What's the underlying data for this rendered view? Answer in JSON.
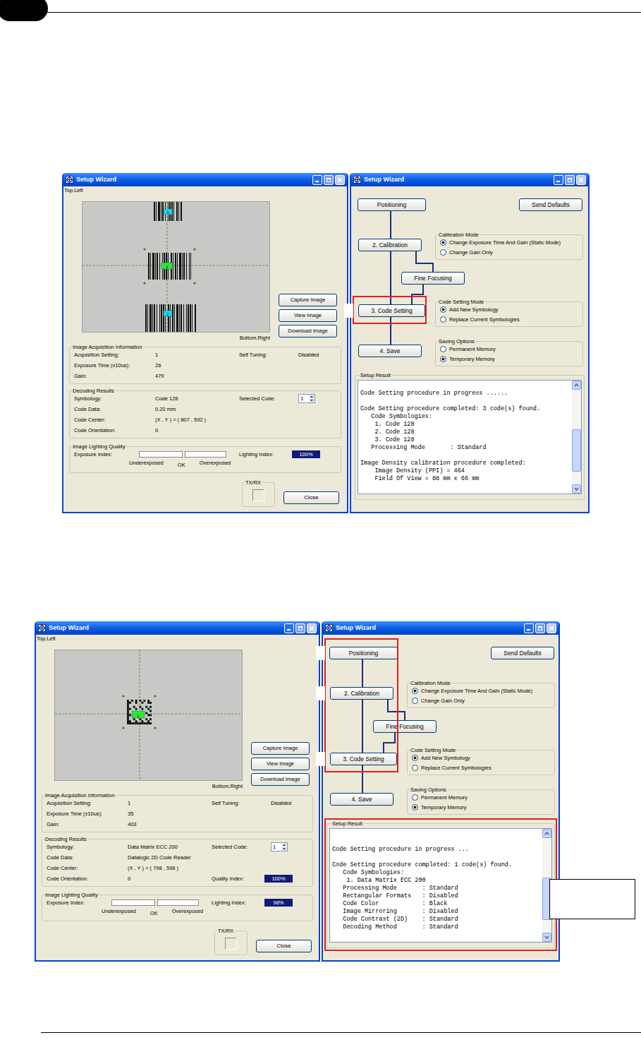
{
  "figures": [
    {
      "left_window": {
        "title": "Setup Wizard",
        "corner_top_left": "Top,Left",
        "corner_bottom_right": "Bottom,Right",
        "image": {
          "kind": "linear",
          "codes": [
            {
              "label": "3",
              "selected": false
            },
            {
              "label": "1",
              "selected": true
            },
            {
              "label": "2",
              "selected": false
            }
          ]
        },
        "image_buttons": [
          "Capture Image",
          "View Image",
          "Download Image"
        ],
        "acquisition": {
          "title": "Image Acquisition Information",
          "rows": [
            {
              "label": "Acquisition Setting:",
              "value": "1",
              "side": {
                "kind": "text",
                "label": "Self Tuning:",
                "value": "Disabled"
              }
            },
            {
              "label": "Exposure Time (x10us):",
              "value": "26"
            },
            {
              "label": "Gain:",
              "value": "479"
            }
          ]
        },
        "decoding": {
          "title": "Decoding Results",
          "rows": [
            {
              "label": "Symbology:",
              "value": "Code 128",
              "side": {
                "kind": "spinner",
                "label": "Selected Code:",
                "value": "1"
              }
            },
            {
              "label": "Code Data:",
              "value": "0.20 mm"
            },
            {
              "label": "Code Center:",
              "value": "(X , Y ) = ( 807 , 592 )"
            },
            {
              "label": "Code Orientation:",
              "value": "0"
            }
          ]
        },
        "lighting": {
          "title": "Image Lighting Quality",
          "exposure_label": "Exposure Index:",
          "exposure_level": 0.5,
          "scale": [
            "Underexposed",
            "OK",
            "Overexposed"
          ],
          "lighting_label": "Lighting Index:",
          "lighting_value": "100%"
        },
        "txrx": "TX/RX",
        "close_button": "Close"
      },
      "right_window": {
        "title": "Setup Wizard",
        "send_defaults": "Send Defaults",
        "steps": [
          {
            "label": "Positioning",
            "highlighted": false
          },
          {
            "label": "2. Calibration",
            "highlighted": false
          },
          {
            "label": "Fine Focusing",
            "highlighted": false
          },
          {
            "label": "3. Code Setting",
            "highlighted": true
          },
          {
            "label": "4. Save",
            "highlighted": false
          }
        ],
        "option_groups": [
          {
            "title": "Calibration Mode",
            "options": [
              {
                "label": "Change Exposure Time And Gain (Static Mode)",
                "selected": true
              },
              {
                "label": "Change Gain Only",
                "selected": false
              }
            ]
          },
          {
            "title": "Code Setting Mode",
            "options": [
              {
                "label": "Add New Symbology",
                "selected": true
              },
              {
                "label": "Replace Current Symbologies",
                "selected": false
              }
            ]
          },
          {
            "title": "Saving Options",
            "options": [
              {
                "label": "Permanent Memory",
                "selected": false
              },
              {
                "label": "Temporary Memory",
                "selected": true
              }
            ]
          }
        ],
        "result": {
          "title": "Setup Result",
          "highlighted": false,
          "scroll_level": 0.9,
          "lines": [
            "",
            "Code Setting procedure in progress ......",
            "",
            "Code Setting procedure completed: 3 code(s) found.",
            "   Code Symbologies:",
            "    1. Code 128",
            "    2. Code 128",
            "    3. Code 128",
            "   Processing Mode       : Standard",
            "",
            "Image Density calibration procedure completed:",
            "    Image Density (PPI) = 464",
            "    Field Of View = 88 mm x 66 mm"
          ]
        }
      }
    },
    {
      "left_window": {
        "title": "Setup Wizard",
        "corner_top_left": "Top,Left",
        "corner_bottom_right": "Bottom,Right",
        "image": {
          "kind": "matrix",
          "codes": [
            {
              "label": "1",
              "selected": true
            }
          ]
        },
        "image_buttons": [
          "Capture Image",
          "View Image",
          "Download Image"
        ],
        "acquisition": {
          "title": "Image Acquisition Information",
          "rows": [
            {
              "label": "Acquisition Setting:",
              "value": "1",
              "side": {
                "kind": "text",
                "label": "Self Tuning:",
                "value": "Disabled"
              }
            },
            {
              "label": "Exposure Time (x10us):",
              "value": "35"
            },
            {
              "label": "Gain:",
              "value": "403"
            }
          ]
        },
        "decoding": {
          "title": "Decoding Results",
          "rows": [
            {
              "label": "Symbology:",
              "value": "Data Matrix ECC 200",
              "side": {
                "kind": "spinner",
                "label": "Selected Code:",
                "value": "1"
              }
            },
            {
              "label": "Code Data:",
              "value": "Datalogic 2D Code Reader"
            },
            {
              "label": "Code Center:",
              "value": "(X , Y ) = ( 798 , 598 )"
            },
            {
              "label": "Code Orientation:",
              "value": "0",
              "side": {
                "kind": "meter",
                "label": "Quality Index:",
                "value": "100%"
              }
            }
          ]
        },
        "lighting": {
          "title": "Image Lighting Quality",
          "exposure_label": "Exposure Index:",
          "exposure_level": 0.5,
          "scale": [
            "Underexposed",
            "OK",
            "Overexposed"
          ],
          "lighting_label": "Lighting Index:",
          "lighting_value": "98%"
        },
        "txrx": "TX/RX",
        "close_button": "Close"
      },
      "right_window": {
        "title": "Setup Wizard",
        "send_defaults": "Send Defaults",
        "steps": [
          {
            "label": "Positioning",
            "highlighted": true
          },
          {
            "label": "2. Calibration",
            "highlighted": true
          },
          {
            "label": "Fine Focusing",
            "highlighted": false
          },
          {
            "label": "3. Code Setting",
            "highlighted": true
          },
          {
            "label": "4. Save",
            "highlighted": false
          }
        ],
        "option_groups": [
          {
            "title": "Calibration Mode",
            "options": [
              {
                "label": "Change Exposure Time And Gain (Static Mode)",
                "selected": true
              },
              {
                "label": "Change Gain Only",
                "selected": false
              }
            ]
          },
          {
            "title": "Code Setting Mode",
            "options": [
              {
                "label": "Add New Symbology",
                "selected": true
              },
              {
                "label": "Replace Current Symbologies",
                "selected": false
              }
            ]
          },
          {
            "title": "Saving Options",
            "options": [
              {
                "label": "Permanent Memory",
                "selected": false
              },
              {
                "label": "Temporary Memory",
                "selected": true
              }
            ]
          }
        ],
        "result": {
          "title": "Setup Result",
          "highlighted": true,
          "scroll_level": 0.9,
          "lines": [
            "",
            "",
            "Code Setting procedure in progress ...",
            "",
            "Code Setting procedure completed: 1 code(s) found.",
            "   Code Symbologies:",
            "    1. Data Matrix ECC 200",
            "   Processing Mode       : Standard",
            "   Rectangular Formats   : Disabled",
            "   Code Color            : Black",
            "   Image Mirroring       : Disabled",
            "   Code Contrast (2D)    : Standard",
            "   Decoding Method       : Standard"
          ]
        }
      }
    }
  ]
}
